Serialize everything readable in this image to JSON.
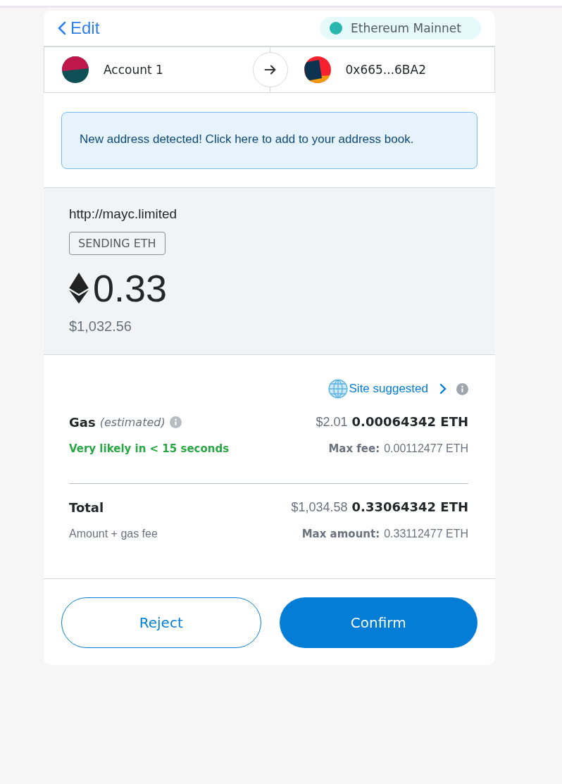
{
  "header": {
    "back_label": "Edit",
    "network": {
      "name": "Ethereum Mainnet",
      "color": "#29b6af"
    }
  },
  "sender": {
    "name": "Account 1"
  },
  "recipient": {
    "address": "0x665...6BA2"
  },
  "notice": "New address detected! Click here to add to your address book.",
  "origin": "http://mayc.limited",
  "badge": "SENDING ETH",
  "amount": "0.33",
  "amount_fiat": "$1,032.56",
  "gas": {
    "suggestion": "Site suggested",
    "label": "Gas",
    "qualifier": "(estimated)",
    "fiat": "$2.01",
    "eth": "0.00064342 ETH",
    "speed": "Very likely in < 15 seconds",
    "max_label": "Max fee:",
    "max_value": "0.00112477 ETH"
  },
  "total": {
    "label": "Total",
    "sublabel": "Amount + gas fee",
    "fiat": "$1,034.58",
    "eth": "0.33064342 ETH",
    "max_label": "Max amount:",
    "max_value": "0.33112477 ETH"
  },
  "buttons": [
    {
      "label": "Reject",
      "kind": "secondary"
    },
    {
      "label": "Confirm",
      "kind": "primary"
    }
  ]
}
